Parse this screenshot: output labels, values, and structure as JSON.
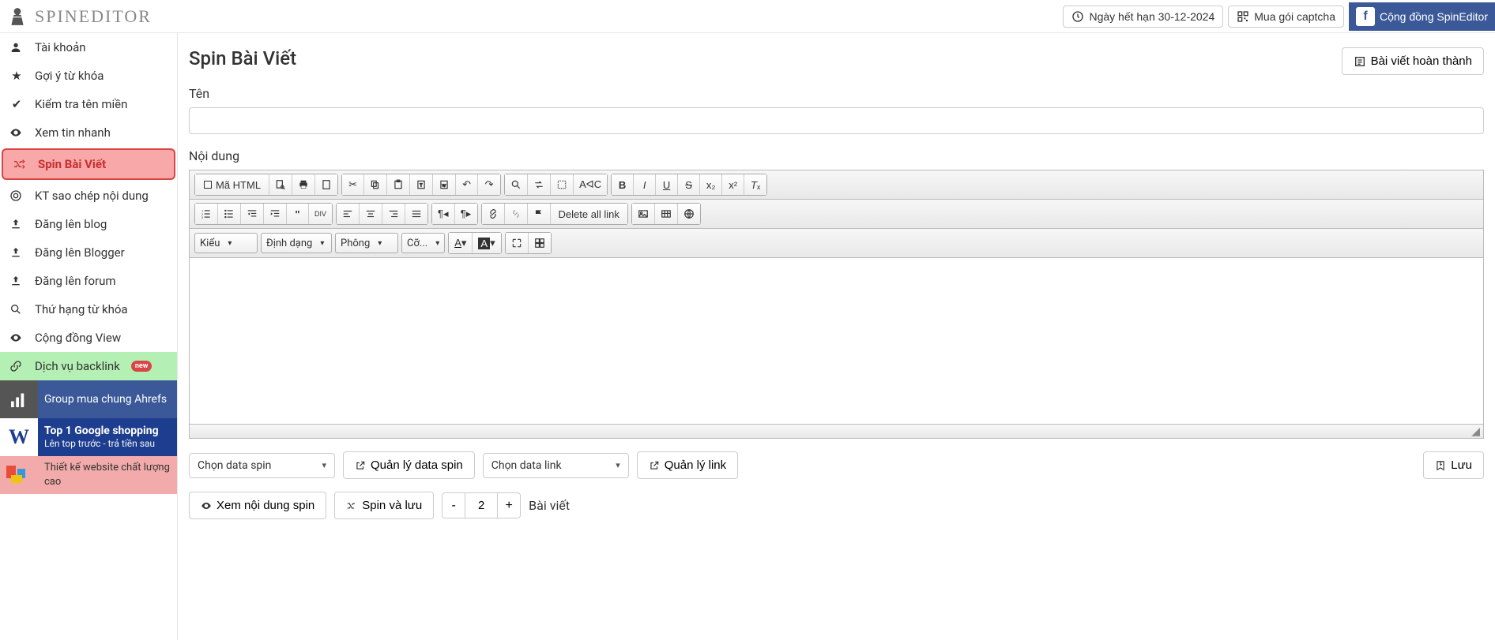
{
  "brand": {
    "name": "SPINEDITOR"
  },
  "header": {
    "expiry_label": "Ngày hết hạn 30-12-2024",
    "buy_captcha": "Mua gói captcha",
    "community": "Cộng đồng SpinEditor"
  },
  "sidebar": {
    "items": [
      {
        "label": "Tài khoản",
        "icon": "user"
      },
      {
        "label": "Gợi ý từ khóa",
        "icon": "star"
      },
      {
        "label": "Kiểm tra tên miền",
        "icon": "check"
      },
      {
        "label": "Xem tin nhanh",
        "icon": "eye"
      },
      {
        "label": "Spin Bài Viết",
        "icon": "shuffle",
        "active": true
      },
      {
        "label": "KT sao chép nội dung",
        "icon": "target"
      },
      {
        "label": "Đăng lên blog",
        "icon": "upload"
      },
      {
        "label": "Đăng lên Blogger",
        "icon": "upload"
      },
      {
        "label": "Đăng lên forum",
        "icon": "upload"
      },
      {
        "label": "Thứ hạng từ khóa",
        "icon": "search"
      },
      {
        "label": "Cộng đồng View",
        "icon": "eye"
      },
      {
        "label": "Dịch vụ backlink",
        "icon": "link",
        "backlink": true,
        "new": "new"
      }
    ],
    "promos": [
      {
        "text": "Group mua chung Ahrefs"
      },
      {
        "title": "Top 1 Google shopping",
        "sub": "Lên top trước - trả tiền sau"
      },
      {
        "text": "Thiết kế website chất lượng cao"
      }
    ]
  },
  "main": {
    "title": "Spin Bài Viết",
    "done_btn": "Bài viết hoàn thành",
    "name_label": "Tên",
    "content_label": "Nội dung",
    "name_value": "",
    "editor": {
      "source_btn": "Mã HTML",
      "delete_link": "Delete all link",
      "style_select": "Kiểu",
      "format_select": "Định dạng",
      "font_select": "Phông",
      "size_select": "Cỡ..."
    },
    "row1": {
      "data_spin_select": "Chọn data spin",
      "manage_spin": "Quản lý data spin",
      "data_link_select": "Chọn data link",
      "manage_link": "Quản lý link",
      "save_btn": "Lưu"
    },
    "row2": {
      "view_spin": "Xem nội dung spin",
      "spin_save": "Spin và lưu",
      "count_value": "2",
      "post_label": "Bài viết"
    }
  }
}
